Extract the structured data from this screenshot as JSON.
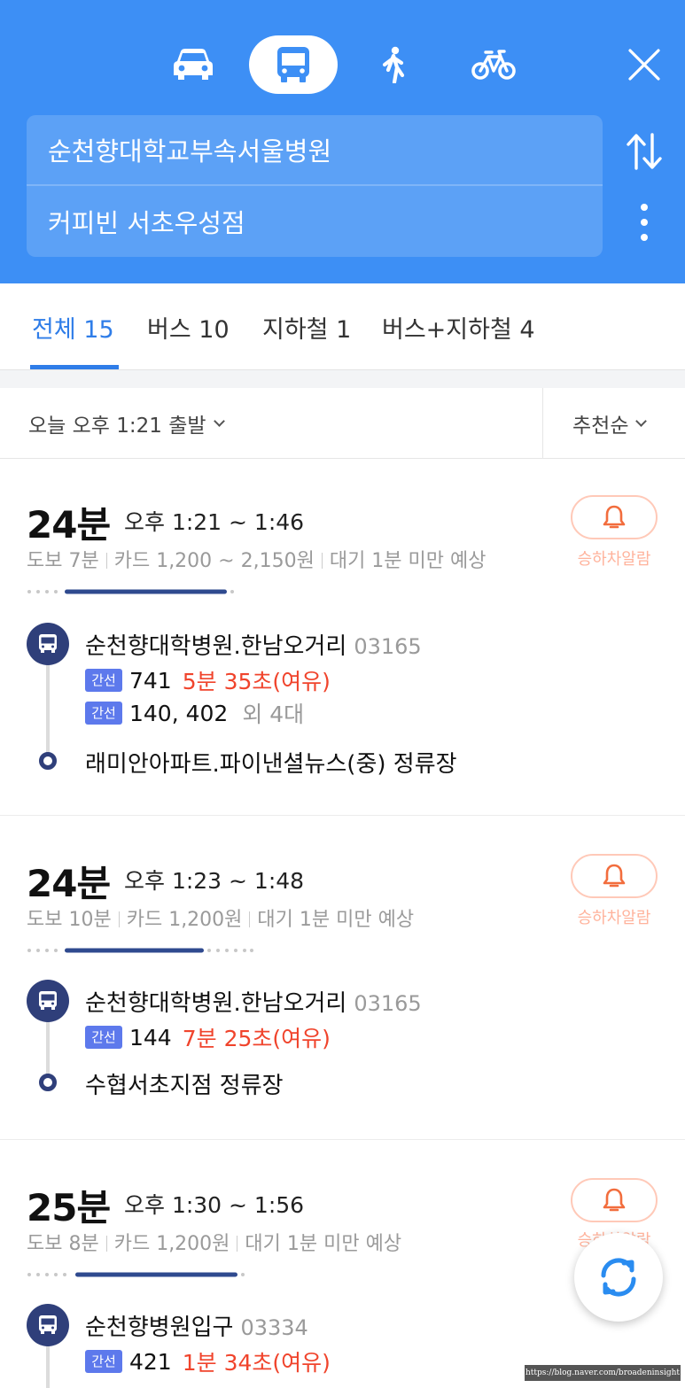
{
  "header": {
    "modes": [
      {
        "name": "car",
        "icon": "car-icon",
        "active": false
      },
      {
        "name": "transit",
        "icon": "bus-icon",
        "active": true
      },
      {
        "name": "walk",
        "icon": "walk-icon",
        "active": false
      },
      {
        "name": "bike",
        "icon": "bike-icon",
        "active": false
      }
    ],
    "origin": "순천향대학교부속서울병원",
    "destination": "커피빈 서초우성점",
    "accent_color": "#3d8ff5"
  },
  "tabs": [
    {
      "label": "전체 15",
      "active": true
    },
    {
      "label": "버스 10",
      "active": false
    },
    {
      "label": "지하철 1",
      "active": false
    },
    {
      "label": "버스+지하철 4",
      "active": false
    }
  ],
  "filter": {
    "departure": "오늘 오후 1:21 출발",
    "sort": "추천순"
  },
  "alarm_label": "승하차알람",
  "routes": [
    {
      "duration": "24분",
      "time_range": "오후 1:21 ~ 1:46",
      "walk": "도보 7분",
      "fare": "카드 1,200 ~ 2,150원",
      "wait": "대기 1분 미만 예상",
      "board_stop": "순천향대학병원.한남오거리",
      "board_stop_id": "03165",
      "lines": [
        {
          "tag": "간선",
          "number": "741",
          "arrival": "5분 35초(여유)",
          "extra": ""
        },
        {
          "tag": "간선",
          "number": "140, 402",
          "arrival": "",
          "extra": "외 4대"
        }
      ],
      "alight_stop": "래미안아파트.파이낸셜뉴스(중) 정류장"
    },
    {
      "duration": "24분",
      "time_range": "오후 1:23 ~ 1:48",
      "walk": "도보 10분",
      "fare": "카드 1,200원",
      "wait": "대기 1분 미만 예상",
      "board_stop": "순천향대학병원.한남오거리",
      "board_stop_id": "03165",
      "lines": [
        {
          "tag": "간선",
          "number": "144",
          "arrival": "7분 25초(여유)",
          "extra": ""
        }
      ],
      "alight_stop": "수협서초지점 정류장"
    },
    {
      "duration": "25분",
      "time_range": "오후 1:30 ~ 1:56",
      "walk": "도보 8분",
      "fare": "카드 1,200원",
      "wait": "대기 1분 미만 예상",
      "board_stop": "순천향병원입구",
      "board_stop_id": "03334",
      "lines": [
        {
          "tag": "간선",
          "number": "421",
          "arrival": "1분 34초(여유)",
          "extra": ""
        }
      ],
      "alight_stop": ""
    }
  ],
  "watermark": "https://blog.naver.com/broadeninsight"
}
